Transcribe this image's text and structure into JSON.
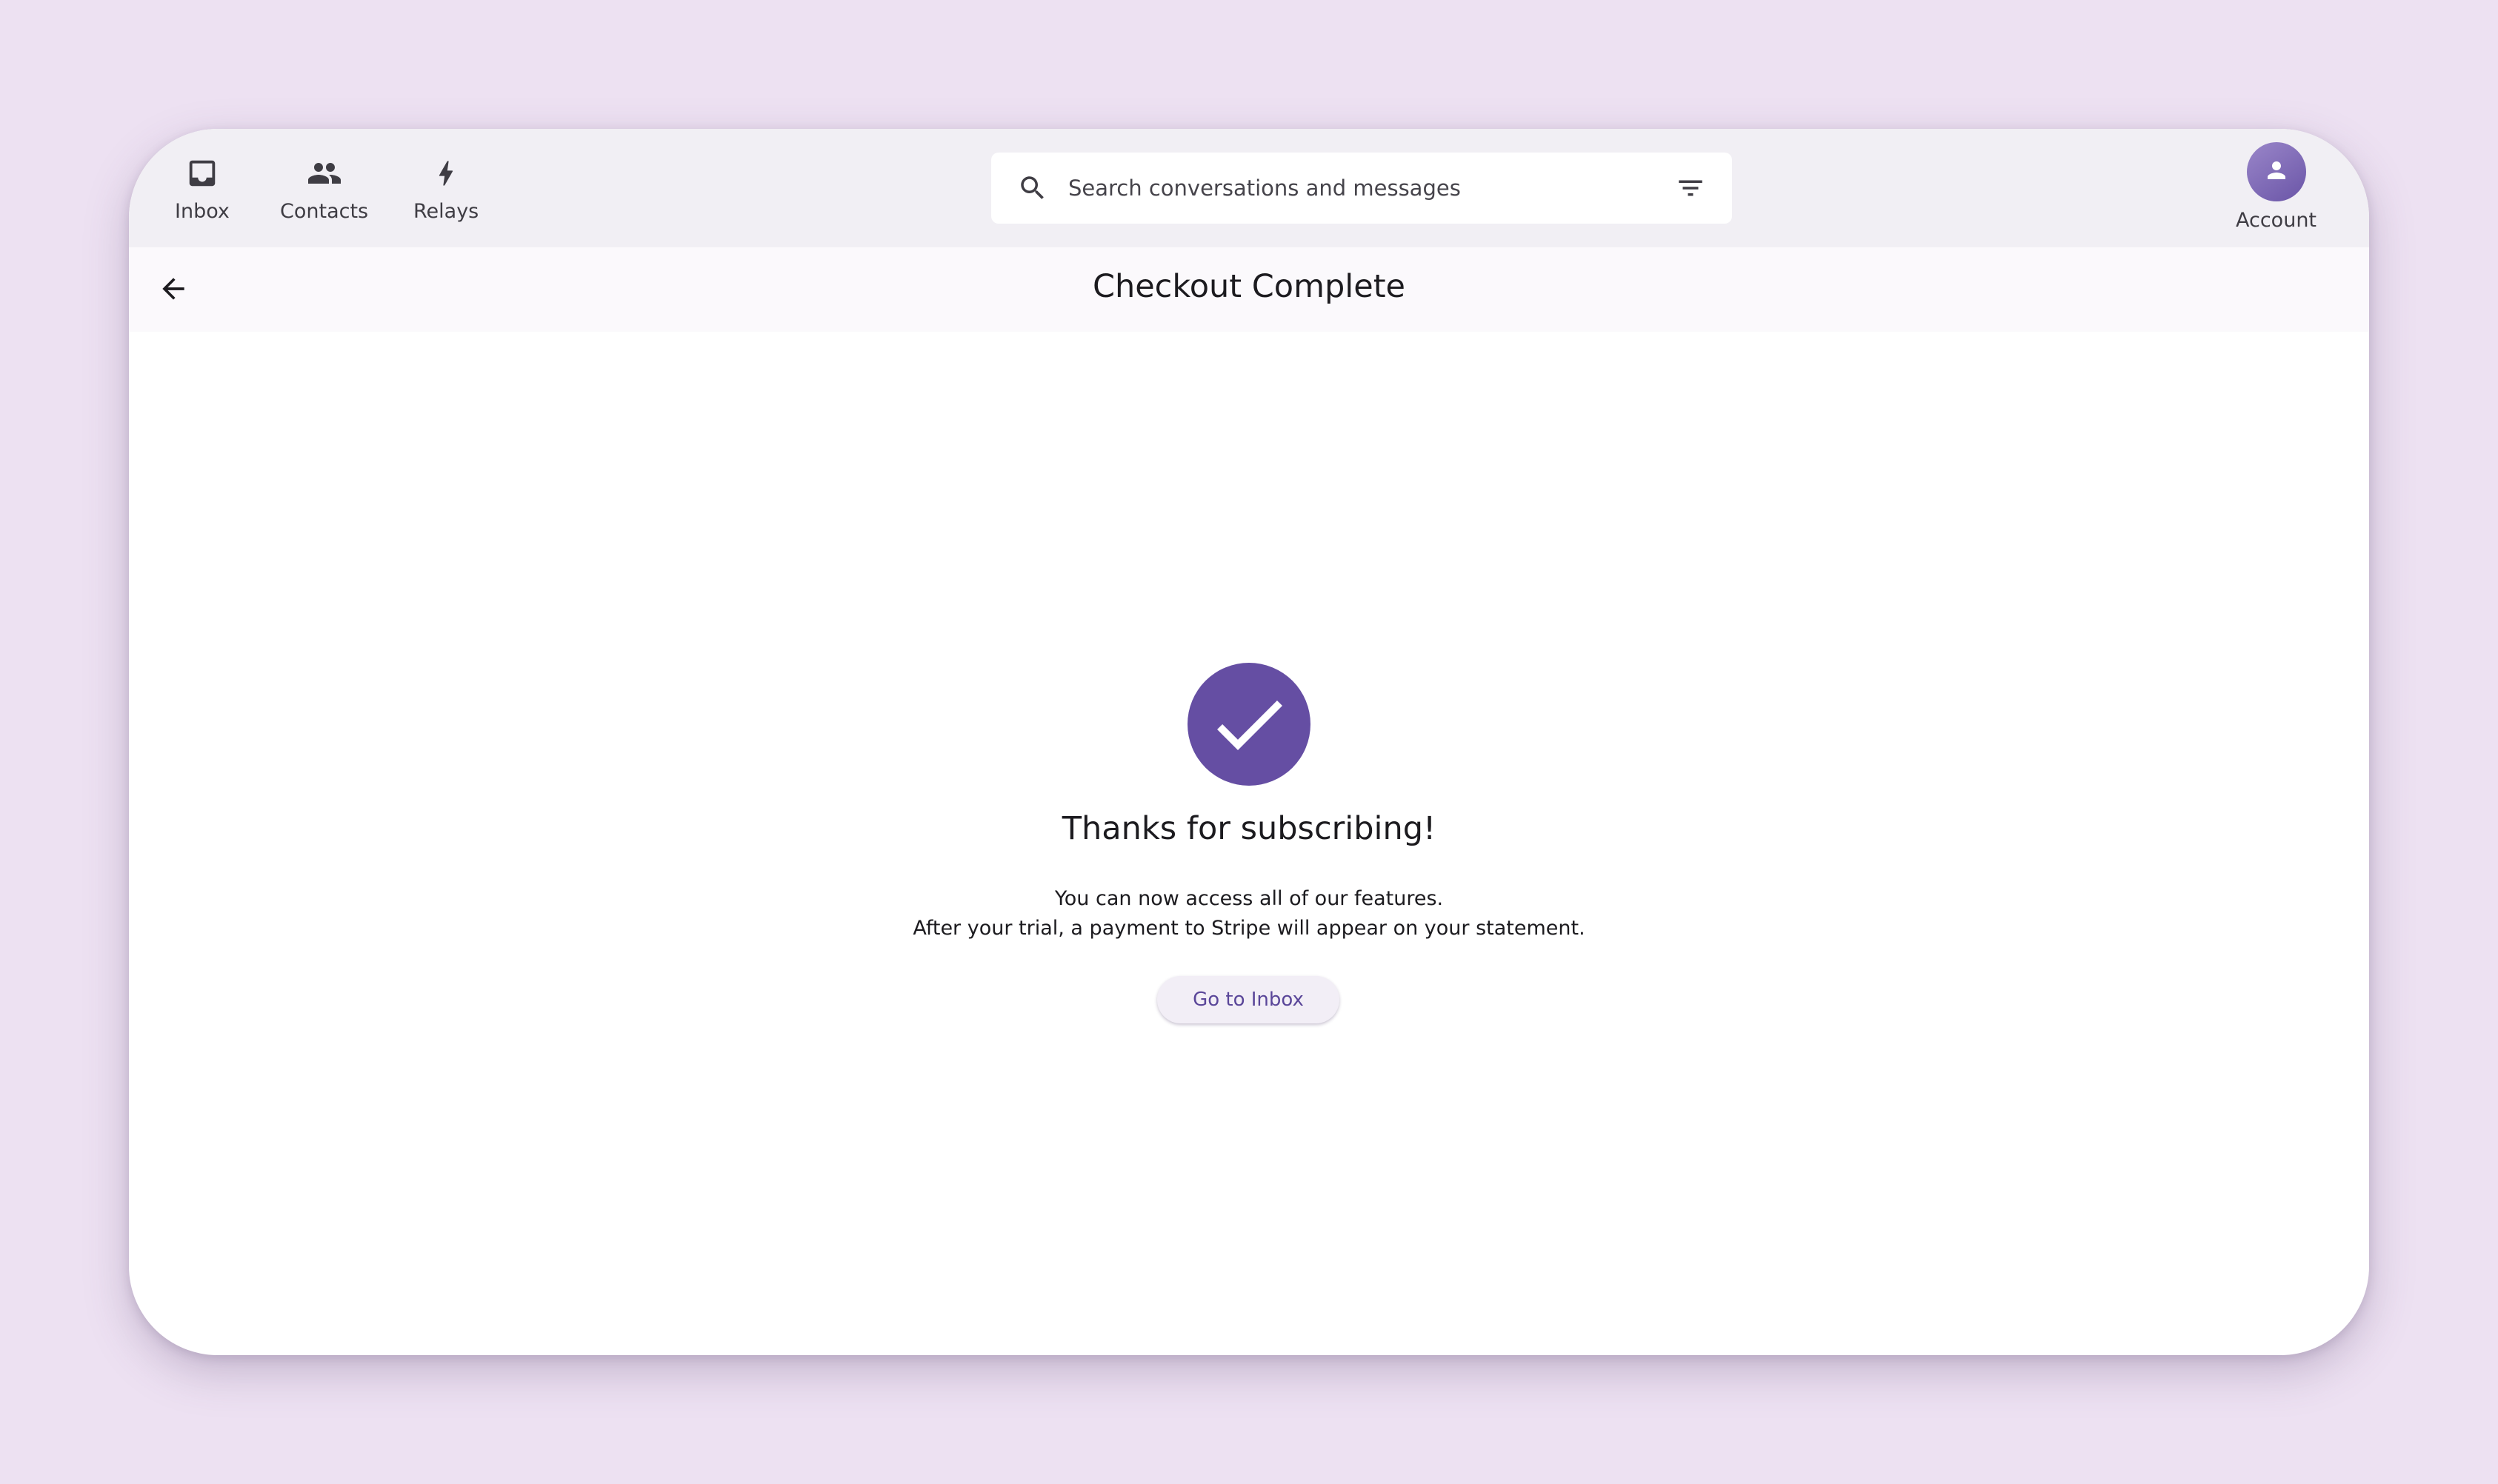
{
  "nav": {
    "inbox_label": "Inbox",
    "contacts_label": "Contacts",
    "relays_label": "Relays",
    "account_label": "Account",
    "icons": {
      "inbox": "inbox-tray-icon",
      "contacts": "people-icon",
      "relays": "bolt-icon",
      "account": "person-icon"
    }
  },
  "search": {
    "placeholder": "Search conversations and messages",
    "icon": "search-icon",
    "filter_icon": "filter-icon"
  },
  "titlebar": {
    "title": "Checkout Complete",
    "back_icon": "arrow-left-icon"
  },
  "main": {
    "success_icon": "check-circle-icon",
    "heading": "Thanks for subscribing!",
    "line1": "You can now access all of our features.",
    "line2": "After your trial, a payment to Stripe will appear on your statement.",
    "button_label": "Go to Inbox"
  },
  "colors": {
    "background": "#ede1f2",
    "accent": "#654ea3",
    "button_text": "#5a4699",
    "topbar": "#f1eff4"
  }
}
